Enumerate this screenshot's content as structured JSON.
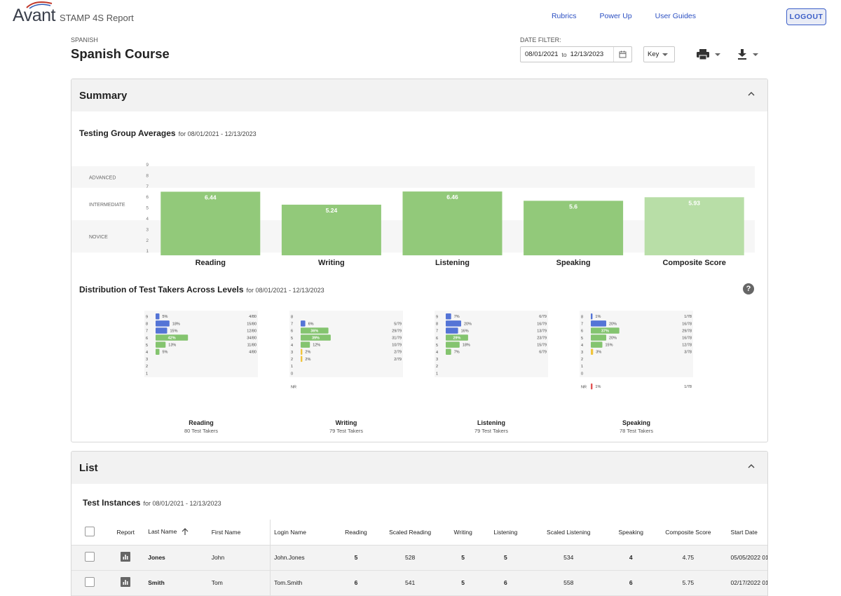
{
  "header": {
    "logo_text": "Avant",
    "app_title": "STAMP 4S Report",
    "links": [
      "Rubrics",
      "Power Up",
      "User Guides"
    ],
    "logout_label": "LOGOUT"
  },
  "page": {
    "subject": "SPANISH",
    "course": "Spanish Course",
    "date_filter_label": "DATE FILTER:",
    "date_from": "08/01/2021",
    "date_to_word": "to",
    "date_to": "12/13/2023",
    "key_label": "Key"
  },
  "summary": {
    "title": "Summary",
    "averages_title": "Testing Group Averages",
    "averages_range": "for 08/01/2021 - 12/13/2023",
    "distribution_title": "Distribution of Test Takers Across Levels",
    "distribution_range": "for 08/01/2021 - 12/13/2023",
    "help_label": "?"
  },
  "chart_data": [
    {
      "type": "bar",
      "title": "",
      "categories": [
        "Reading",
        "Writing",
        "Listening",
        "Speaking",
        "Composite Score"
      ],
      "values": [
        6.44,
        5.24,
        6.46,
        5.6,
        5.93
      ],
      "value_labels": [
        "6.44",
        "5.24",
        "6.46",
        "5.6",
        "5.93"
      ],
      "ylim": [
        0,
        9
      ],
      "y_ticks": [
        "9",
        "8",
        "7",
        "6",
        "5",
        "4",
        "3",
        "2",
        "1"
      ],
      "bands": [
        {
          "label": "ADVANCED",
          "range": [
            7,
            9
          ]
        },
        {
          "label": "INTERMEDIATE",
          "range": [
            4,
            7
          ]
        },
        {
          "label": "NOVICE",
          "range": [
            1,
            4
          ]
        }
      ],
      "colors": {
        "bar": "#92c97a",
        "composite": "#b8dea7",
        "band": "#f6f6f6",
        "label": "#ffffff"
      }
    },
    {
      "type": "bar",
      "title": "",
      "colors": {
        "high": "#5474d6",
        "mid": "#84c46f",
        "low": "#f0c43c",
        "nr": "#e25555",
        "panel": "#f6f6f6"
      },
      "panels": [
        {
          "name": "Reading",
          "subtitle": "80 Test Takers",
          "show_nr": false,
          "levels": [
            "9",
            "8",
            "7",
            "6",
            "5",
            "4",
            "3",
            "2",
            "1"
          ],
          "percents": [
            5,
            18,
            15,
            42,
            13,
            5,
            0,
            0,
            0
          ],
          "pct_labels": [
            "5%",
            "18%",
            "15%",
            "42%",
            "13%",
            "5%",
            "",
            "",
            ""
          ],
          "counts": [
            "4/80",
            "15/80",
            "12/80",
            "34/80",
            "11/80",
            "4/80",
            "",
            "",
            ""
          ]
        },
        {
          "name": "Writing",
          "subtitle": "79 Test Takers",
          "show_nr": true,
          "levels": [
            "8",
            "7",
            "6",
            "5",
            "4",
            "3",
            "2",
            "1",
            "0",
            "NR"
          ],
          "percents": [
            0,
            6,
            36,
            39,
            12,
            2,
            2,
            0,
            0,
            0
          ],
          "pct_labels": [
            "",
            "6%",
            "36%",
            "39%",
            "12%",
            "2%",
            "2%",
            "",
            "",
            ""
          ],
          "counts": [
            "",
            "5/79",
            "29/79",
            "31/79",
            "10/79",
            "2/79",
            "2/79",
            "",
            "",
            ""
          ]
        },
        {
          "name": "Listening",
          "subtitle": "79 Test Takers",
          "show_nr": false,
          "levels": [
            "9",
            "8",
            "7",
            "6",
            "5",
            "4",
            "3",
            "2",
            "1"
          ],
          "percents": [
            7,
            20,
            16,
            29,
            18,
            7,
            0,
            0,
            0
          ],
          "pct_labels": [
            "7%",
            "20%",
            "16%",
            "29%",
            "18%",
            "7%",
            "",
            "",
            ""
          ],
          "counts": [
            "6/79",
            "16/79",
            "13/79",
            "23/79",
            "15/79",
            "6/79",
            "",
            "",
            ""
          ]
        },
        {
          "name": "Speaking",
          "subtitle": "78 Test Takers",
          "show_nr": true,
          "levels": [
            "8",
            "7",
            "6",
            "5",
            "4",
            "3",
            "2",
            "1",
            "0",
            "NR"
          ],
          "percents": [
            1,
            20,
            37,
            20,
            15,
            3,
            0,
            0,
            0,
            1
          ],
          "pct_labels": [
            "1%",
            "20%",
            "37%",
            "20%",
            "15%",
            "3%",
            "",
            "",
            "",
            "1%"
          ],
          "counts": [
            "1/78",
            "16/78",
            "29/78",
            "16/78",
            "12/78",
            "3/78",
            "",
            "",
            "",
            "1/78"
          ]
        }
      ]
    }
  ],
  "list": {
    "title": "List",
    "instances_title": "Test Instances",
    "instances_range": "for 08/01/2021 - 12/13/2023",
    "columns": [
      "Report",
      "Last Name",
      "First Name",
      "Login Name",
      "Reading",
      "Scaled Reading",
      "Writing",
      "Listening",
      "Scaled Listening",
      "Speaking",
      "Composite Score",
      "Start Date"
    ],
    "rows": [
      {
        "last": "Jones",
        "first": "John",
        "login": "John.Jones",
        "reading": "5",
        "scaled_reading": "528",
        "writing": "5",
        "listening": "5",
        "scaled_listening": "534",
        "speaking": "4",
        "composite": "4.75",
        "start": "05/05/2022 01"
      },
      {
        "last": "Smith",
        "first": "Tom",
        "login": "Tom.Smith",
        "reading": "6",
        "scaled_reading": "541",
        "writing": "5",
        "listening": "6",
        "scaled_listening": "558",
        "speaking": "6",
        "composite": "5.75",
        "start": "02/17/2022 01"
      }
    ]
  }
}
